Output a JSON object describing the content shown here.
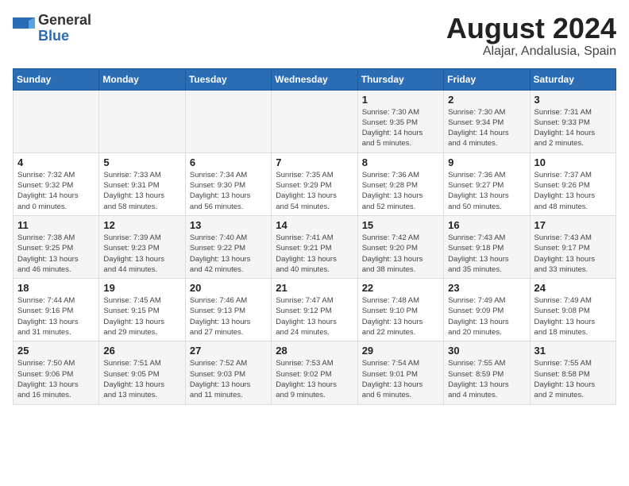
{
  "header": {
    "logo_general": "General",
    "logo_blue": "Blue",
    "title": "August 2024",
    "subtitle": "Alajar, Andalusia, Spain"
  },
  "days_of_week": [
    "Sunday",
    "Monday",
    "Tuesday",
    "Wednesday",
    "Thursday",
    "Friday",
    "Saturday"
  ],
  "weeks": [
    [
      {
        "day": "",
        "info": ""
      },
      {
        "day": "",
        "info": ""
      },
      {
        "day": "",
        "info": ""
      },
      {
        "day": "",
        "info": ""
      },
      {
        "day": "1",
        "info": "Sunrise: 7:30 AM\nSunset: 9:35 PM\nDaylight: 14 hours\nand 5 minutes."
      },
      {
        "day": "2",
        "info": "Sunrise: 7:30 AM\nSunset: 9:34 PM\nDaylight: 14 hours\nand 4 minutes."
      },
      {
        "day": "3",
        "info": "Sunrise: 7:31 AM\nSunset: 9:33 PM\nDaylight: 14 hours\nand 2 minutes."
      }
    ],
    [
      {
        "day": "4",
        "info": "Sunrise: 7:32 AM\nSunset: 9:32 PM\nDaylight: 14 hours\nand 0 minutes."
      },
      {
        "day": "5",
        "info": "Sunrise: 7:33 AM\nSunset: 9:31 PM\nDaylight: 13 hours\nand 58 minutes."
      },
      {
        "day": "6",
        "info": "Sunrise: 7:34 AM\nSunset: 9:30 PM\nDaylight: 13 hours\nand 56 minutes."
      },
      {
        "day": "7",
        "info": "Sunrise: 7:35 AM\nSunset: 9:29 PM\nDaylight: 13 hours\nand 54 minutes."
      },
      {
        "day": "8",
        "info": "Sunrise: 7:36 AM\nSunset: 9:28 PM\nDaylight: 13 hours\nand 52 minutes."
      },
      {
        "day": "9",
        "info": "Sunrise: 7:36 AM\nSunset: 9:27 PM\nDaylight: 13 hours\nand 50 minutes."
      },
      {
        "day": "10",
        "info": "Sunrise: 7:37 AM\nSunset: 9:26 PM\nDaylight: 13 hours\nand 48 minutes."
      }
    ],
    [
      {
        "day": "11",
        "info": "Sunrise: 7:38 AM\nSunset: 9:25 PM\nDaylight: 13 hours\nand 46 minutes."
      },
      {
        "day": "12",
        "info": "Sunrise: 7:39 AM\nSunset: 9:23 PM\nDaylight: 13 hours\nand 44 minutes."
      },
      {
        "day": "13",
        "info": "Sunrise: 7:40 AM\nSunset: 9:22 PM\nDaylight: 13 hours\nand 42 minutes."
      },
      {
        "day": "14",
        "info": "Sunrise: 7:41 AM\nSunset: 9:21 PM\nDaylight: 13 hours\nand 40 minutes."
      },
      {
        "day": "15",
        "info": "Sunrise: 7:42 AM\nSunset: 9:20 PM\nDaylight: 13 hours\nand 38 minutes."
      },
      {
        "day": "16",
        "info": "Sunrise: 7:43 AM\nSunset: 9:18 PM\nDaylight: 13 hours\nand 35 minutes."
      },
      {
        "day": "17",
        "info": "Sunrise: 7:43 AM\nSunset: 9:17 PM\nDaylight: 13 hours\nand 33 minutes."
      }
    ],
    [
      {
        "day": "18",
        "info": "Sunrise: 7:44 AM\nSunset: 9:16 PM\nDaylight: 13 hours\nand 31 minutes."
      },
      {
        "day": "19",
        "info": "Sunrise: 7:45 AM\nSunset: 9:15 PM\nDaylight: 13 hours\nand 29 minutes."
      },
      {
        "day": "20",
        "info": "Sunrise: 7:46 AM\nSunset: 9:13 PM\nDaylight: 13 hours\nand 27 minutes."
      },
      {
        "day": "21",
        "info": "Sunrise: 7:47 AM\nSunset: 9:12 PM\nDaylight: 13 hours\nand 24 minutes."
      },
      {
        "day": "22",
        "info": "Sunrise: 7:48 AM\nSunset: 9:10 PM\nDaylight: 13 hours\nand 22 minutes."
      },
      {
        "day": "23",
        "info": "Sunrise: 7:49 AM\nSunset: 9:09 PM\nDaylight: 13 hours\nand 20 minutes."
      },
      {
        "day": "24",
        "info": "Sunrise: 7:49 AM\nSunset: 9:08 PM\nDaylight: 13 hours\nand 18 minutes."
      }
    ],
    [
      {
        "day": "25",
        "info": "Sunrise: 7:50 AM\nSunset: 9:06 PM\nDaylight: 13 hours\nand 16 minutes."
      },
      {
        "day": "26",
        "info": "Sunrise: 7:51 AM\nSunset: 9:05 PM\nDaylight: 13 hours\nand 13 minutes."
      },
      {
        "day": "27",
        "info": "Sunrise: 7:52 AM\nSunset: 9:03 PM\nDaylight: 13 hours\nand 11 minutes."
      },
      {
        "day": "28",
        "info": "Sunrise: 7:53 AM\nSunset: 9:02 PM\nDaylight: 13 hours\nand 9 minutes."
      },
      {
        "day": "29",
        "info": "Sunrise: 7:54 AM\nSunset: 9:01 PM\nDaylight: 13 hours\nand 6 minutes."
      },
      {
        "day": "30",
        "info": "Sunrise: 7:55 AM\nSunset: 8:59 PM\nDaylight: 13 hours\nand 4 minutes."
      },
      {
        "day": "31",
        "info": "Sunrise: 7:55 AM\nSunset: 8:58 PM\nDaylight: 13 hours\nand 2 minutes."
      }
    ]
  ]
}
